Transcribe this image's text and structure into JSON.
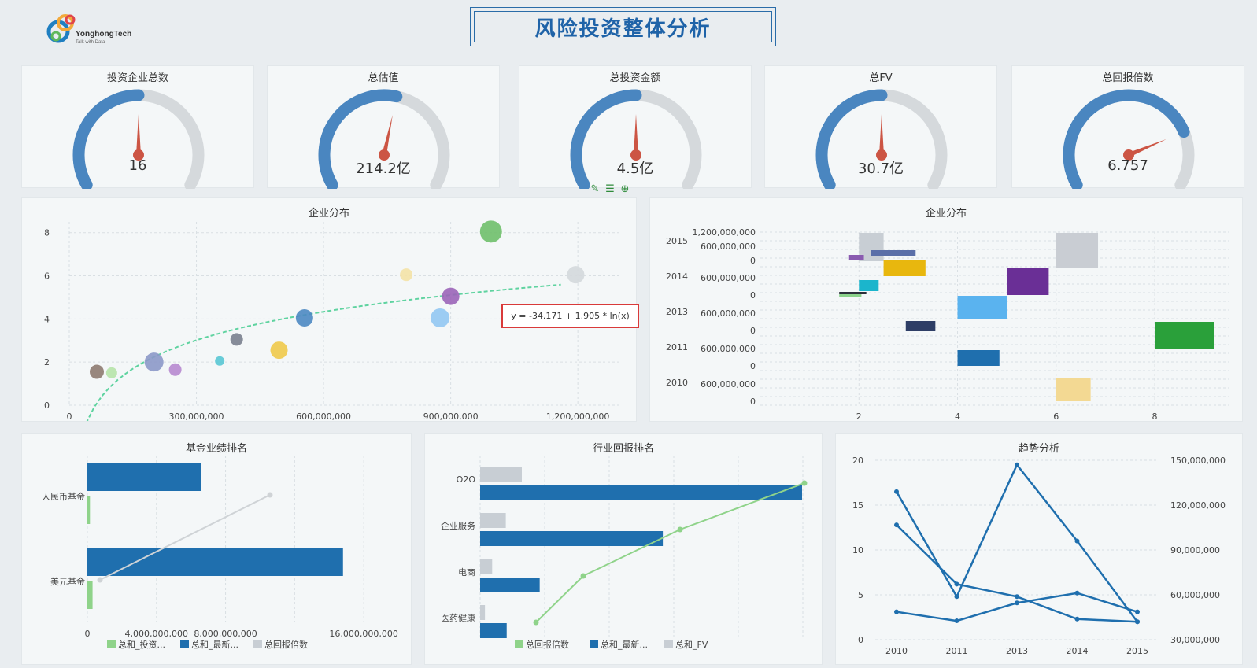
{
  "header": {
    "logo_name": "YonghongTech",
    "logo_tagline": "Talk with Data",
    "title": "风险投资整体分析"
  },
  "gauges": [
    {
      "title": "投资企业总数",
      "value": "16",
      "fill_fraction": 0.5
    },
    {
      "title": "总估值",
      "value": "214.2亿",
      "fill_fraction": 0.55
    },
    {
      "title": "总投资金额",
      "value": "4.5亿",
      "fill_fraction": 0.5
    },
    {
      "title": "总FV",
      "value": "30.7亿",
      "fill_fraction": 0.5
    },
    {
      "title": "总回报倍数",
      "value": "6.757",
      "fill_fraction": 0.78
    }
  ],
  "toolbar": {
    "icons": [
      "pencil-icon",
      "list-icon",
      "zoom-in-icon"
    ]
  },
  "colors": {
    "accent_blue": "#4a86c0",
    "needle": "#cc5544",
    "gauge_track": "#d5d9dc",
    "bar_blue": "#1f6fae",
    "green": "#8fd38a",
    "gray_bar": "#c8ced4",
    "line_blue": "#1f6fae",
    "trend_green": "#5fd3a0"
  },
  "chart_data": [
    {
      "type": "scatter",
      "title": "企业分布",
      "x_ticks": [
        "0",
        "300,000,000",
        "600,000,000",
        "900,000,000",
        "1,200,000,000"
      ],
      "y_ticks": [
        "0",
        "2",
        "4",
        "6",
        "8"
      ],
      "xlim": [
        0,
        1300000000
      ],
      "ylim": [
        0,
        8.5
      ],
      "points": [
        {
          "x": 65000000,
          "y": 1.55,
          "r": 9,
          "color": "#8e7a70"
        },
        {
          "x": 100000000,
          "y": 1.5,
          "r": 7,
          "color": "#b7e3a8"
        },
        {
          "x": 200000000,
          "y": 2.0,
          "r": 12,
          "color": "#8c98c8"
        },
        {
          "x": 250000000,
          "y": 1.65,
          "r": 8,
          "color": "#b788cf"
        },
        {
          "x": 355000000,
          "y": 2.05,
          "r": 6,
          "color": "#59c7d4"
        },
        {
          "x": 395000000,
          "y": 3.05,
          "r": 8,
          "color": "#7a7f8e"
        },
        {
          "x": 495000000,
          "y": 2.55,
          "r": 11,
          "color": "#efc94a"
        },
        {
          "x": 555000000,
          "y": 4.05,
          "r": 11,
          "color": "#4c88c2"
        },
        {
          "x": 795000000,
          "y": 6.05,
          "r": 8,
          "color": "#f4e2a6"
        },
        {
          "x": 875000000,
          "y": 4.05,
          "r": 12,
          "color": "#92c7f2"
        },
        {
          "x": 900000000,
          "y": 5.05,
          "r": 11,
          "color": "#9b64b8"
        },
        {
          "x": 995000000,
          "y": 8.05,
          "r": 14,
          "color": "#6fbf6a"
        },
        {
          "x": 1195000000,
          "y": 6.05,
          "r": 11,
          "color": "#d4d8dc"
        }
      ],
      "trendline": {
        "label": "y = -34.171 + 1.905 * ln(x)",
        "a": -34.171,
        "b": 1.905,
        "x_from": 40000000,
        "x_to": 1160000000
      }
    },
    {
      "type": "bar",
      "title": "企业分布",
      "description": "floating bars per year row",
      "x_ticks": [
        "2",
        "4",
        "6",
        "8"
      ],
      "xlim": [
        0,
        9.5
      ],
      "rows": [
        {
          "year": "2015",
          "ticks": [
            "1,200,000,000",
            "600,000,000",
            "0"
          ]
        },
        {
          "year": "2014",
          "ticks": [
            "600,000,000",
            "0"
          ]
        },
        {
          "year": "2013",
          "ticks": [
            "600,000,000",
            "0"
          ]
        },
        {
          "year": "2011",
          "ticks": [
            "600,000,000",
            "0"
          ]
        },
        {
          "year": "2010",
          "ticks": [
            "600,000,000",
            "0"
          ]
        }
      ]
    },
    {
      "type": "bar",
      "title": "基金业绩排名",
      "categories": [
        "人民币基金",
        "美元基金"
      ],
      "x_ticks": [
        "0",
        "4,000,000,000",
        "8,000,000,000",
        "16,000,000,000"
      ],
      "xlim": [
        0,
        18000000000
      ],
      "series": [
        {
          "name": "总和_投资...",
          "values": [
            150000000,
            300000000
          ]
        },
        {
          "name": "总和_最新...",
          "values": [
            6600000000,
            14800000000
          ]
        },
        {
          "name": "总回报倍数",
          "values": [
            10.5,
            0.5
          ]
        }
      ]
    },
    {
      "type": "bar",
      "title": "行业回报排名",
      "categories": [
        "O2O",
        "企业服务",
        "电商",
        "医药健康"
      ],
      "series": [
        {
          "name": "总回报倍数",
          "values": [
            16,
            12.7,
            6.1,
            3.1
          ]
        },
        {
          "name": "总和_最新...",
          "values": [
            400,
            227,
            74,
            33
          ]
        },
        {
          "name": "总和_FV",
          "values": [
            52,
            32,
            15,
            6
          ]
        }
      ]
    },
    {
      "type": "line",
      "title": "趋势分析",
      "x": [
        "2010",
        "2011",
        "2013",
        "2014",
        "2015"
      ],
      "y_ticks_left": [
        "0",
        "5",
        "10",
        "15",
        "20"
      ],
      "y_ticks_right": [
        "30,000,000",
        "60,000,000",
        "90,000,000",
        "120,000,000",
        "150,000,000"
      ],
      "ylim_left": [
        0,
        20
      ],
      "series": [
        {
          "axis": "left",
          "values": [
            16.5,
            4.8,
            19.5,
            11.0,
            2.0
          ]
        },
        {
          "axis": "left",
          "values": [
            12.8,
            6.2,
            4.8,
            2.3,
            2.0
          ]
        },
        {
          "axis": "left",
          "values": [
            3.1,
            2.1,
            4.1,
            5.2,
            3.1
          ]
        }
      ]
    }
  ]
}
